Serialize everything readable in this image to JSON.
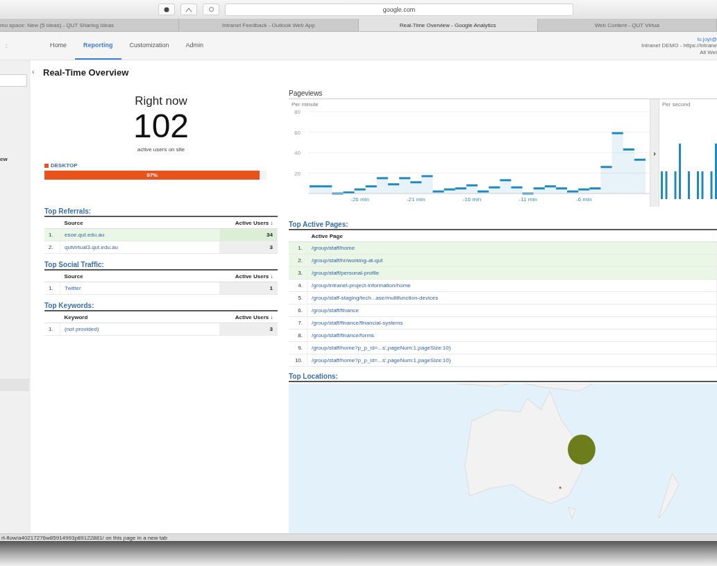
{
  "browser": {
    "address": "google.com"
  },
  "tabs": [
    {
      "label": "mo space: New (5 ideas) - QUT Sharing Ideas",
      "selected": false
    },
    {
      "label": "Intranet Feedback - Outlook Web App",
      "selected": false
    },
    {
      "label": "Real-Time Overview - Google Analytics",
      "selected": true
    },
    {
      "label": "Web Content - QUT Virtua",
      "selected": false
    }
  ],
  "nav": {
    "left_fragment": ":",
    "items": [
      {
        "label": "Home",
        "selected": false
      },
      {
        "label": "Reporting",
        "selected": true
      },
      {
        "label": "Customization",
        "selected": false
      },
      {
        "label": "Admin",
        "selected": false
      }
    ],
    "account": [
      "lu.joyi@",
      "Intranet DEMO - https://intrane",
      "All Wel"
    ]
  },
  "sidebar": {
    "collapse_glyph": "‹",
    "items": [
      {
        "label": "ew"
      }
    ]
  },
  "page_title": "Real-Time Overview",
  "right_now": {
    "heading": "Right now",
    "count": "102",
    "caption": "active users on site"
  },
  "devices": [
    {
      "label": "DESKTOP",
      "color": "#e8531c",
      "level": 0.97,
      "reading": "97%"
    }
  ],
  "left_tables": [
    {
      "title": "Top Referrals:",
      "columns": [
        "Source",
        "Active Users ↓"
      ],
      "rows": [
        {
          "index": "1.",
          "label": "esoe.qut.edu.au",
          "value": "34",
          "highlighted": true
        },
        {
          "index": "2.",
          "label": "qutvirtual3.qut.edu.au",
          "value": "3",
          "highlighted": false
        }
      ]
    },
    {
      "title": "Top Social Traffic:",
      "columns": [
        "Source",
        "Active Users ↓"
      ],
      "rows": [
        {
          "index": "1.",
          "label": "Twitter",
          "value": "1",
          "highlighted": false
        }
      ]
    },
    {
      "title": "Top Keywords:",
      "columns": [
        "Keyword",
        "Active Users ↓"
      ],
      "rows": [
        {
          "index": "1.",
          "label": "(not provided)",
          "value": "3",
          "highlighted": false
        }
      ]
    }
  ],
  "pageviews": {
    "title": "Pageviews",
    "expand_glyph": "›",
    "per_minute": {
      "label": "Per minute",
      "chart_data": {
        "type": "bar",
        "x": [
          -30,
          -29,
          -28,
          -27,
          -26,
          -25,
          -24,
          -23,
          -22,
          -21,
          -20,
          -19,
          -18,
          -17,
          -16,
          -15,
          -14,
          -13,
          -12,
          -11,
          -10,
          -9,
          -8,
          -7,
          -6,
          -5,
          -4,
          -3,
          -2,
          -1
        ],
        "series": [
          {
            "color": "#1f8ac0",
            "values": [
              7,
              7,
              0,
              1,
              4,
              7,
              15,
              9,
              15,
              11,
              17,
              2,
              4,
              5,
              8,
              2,
              6,
              13,
              6,
              0,
              5,
              7,
              5,
              2,
              4,
              5,
              26,
              59,
              43,
              33
            ]
          }
        ],
        "xlim": [
          -30.5,
          -0.5
        ],
        "grid": true,
        "ylim": [
          0,
          80
        ],
        "yticks": [
          20,
          40,
          60,
          80
        ],
        "xticks": [
          {
            "value": -26,
            "label": "-26 min"
          },
          {
            "value": -21,
            "label": "-21 min"
          },
          {
            "value": -16,
            "label": "-16 min"
          },
          {
            "value": -11,
            "label": "-11 min"
          },
          {
            "value": -6,
            "label": "-6 min"
          }
        ]
      }
    },
    "per_second": {
      "label": "Per second"
    }
  },
  "active_pages": {
    "title": "Top Active Pages:",
    "columns": [
      "Active Page"
    ],
    "rows": [
      {
        "index": "1.",
        "label": "/group/staff/home",
        "highlighted": true
      },
      {
        "index": "2.",
        "label": "/group/staff/hr/working-at-qut",
        "highlighted": true
      },
      {
        "index": "3.",
        "label": "/group/staff/personal-profile",
        "highlighted": true
      },
      {
        "index": "4.",
        "label": "/group/intranet-project-information/home",
        "highlighted": false
      },
      {
        "index": "5.",
        "label": "/group/staff-staging/tech...ase/multifunction-devices",
        "highlighted": false
      },
      {
        "index": "6.",
        "label": "/group/staff/finance",
        "highlighted": false
      },
      {
        "index": "7.",
        "label": "/group/staff/finance/financial-systems",
        "highlighted": false
      },
      {
        "index": "8.",
        "label": "/group/staff/finance/forms",
        "highlighted": false
      },
      {
        "index": "9.",
        "label": "/group/staff/home?p_p_id=...s',pageNum:1,pageSize:10)",
        "highlighted": false
      },
      {
        "index": "10.",
        "label": "/group/staff/home?p_p_id=...s',pageNum:1,pageSize:10)",
        "highlighted": false
      }
    ]
  },
  "locations": {
    "title": "Top Locations:"
  },
  "status_bar": "rt-flow/a40217276w85914993p89122881/ on this page in a new tab"
}
